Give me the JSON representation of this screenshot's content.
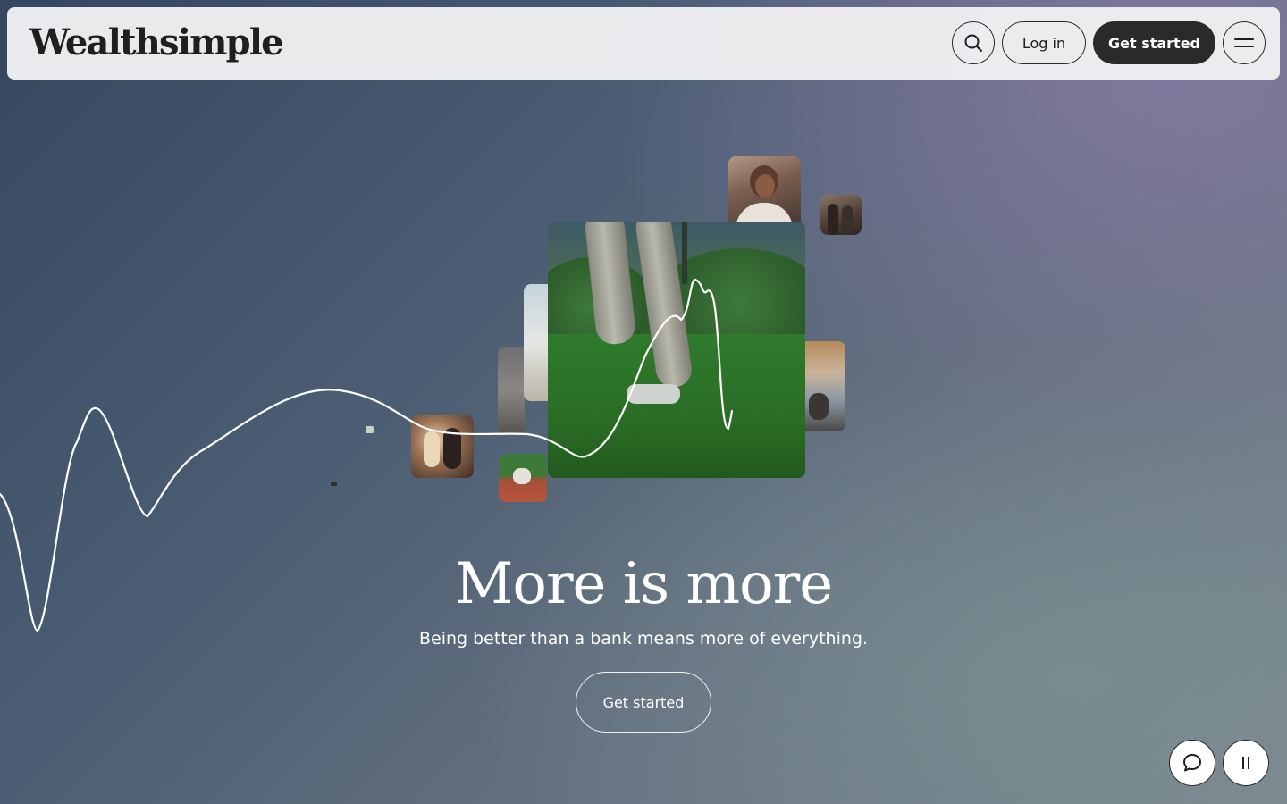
{
  "header": {
    "logo": "Wealthsimple",
    "search_icon": "search-icon",
    "login_label": "Log in",
    "get_started_label": "Get started",
    "menu_icon": "menu-icon"
  },
  "hero": {
    "headline": "More is more",
    "subheadline": "Being better than a bank means more of everything.",
    "cta_label": "Get started"
  },
  "floating": {
    "chat_icon": "chat-bubble-icon",
    "pause_icon": "pause-icon"
  },
  "colors": {
    "primary_button": "#2b2a29",
    "header_background": "#f0f0f2",
    "text_light": "#ffffff",
    "wave_line": "#ffffff"
  }
}
